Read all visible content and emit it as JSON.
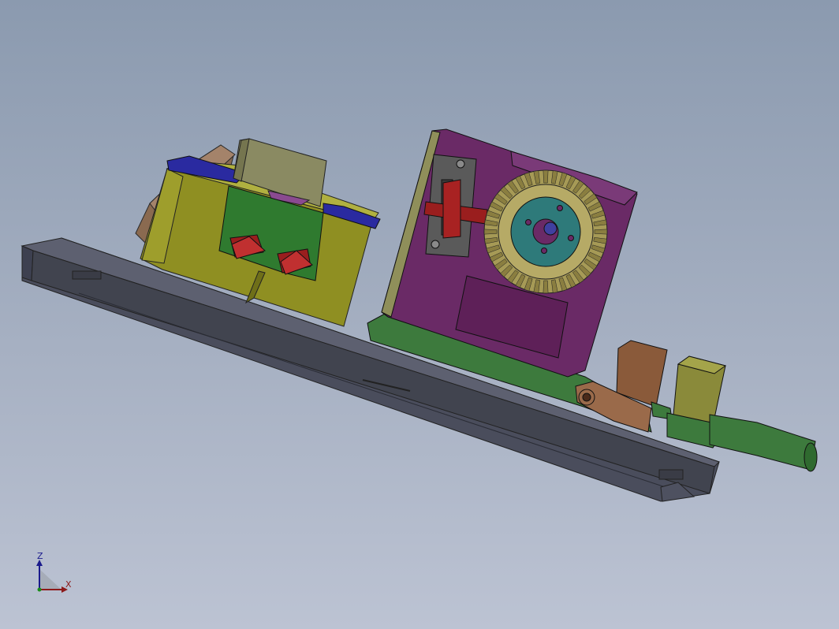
{
  "viewport": {
    "background_top": "#8b9aaf",
    "background_bottom": "#bcc3d3"
  },
  "triad": {
    "z_label": "Z",
    "x_label": "X",
    "z_color": "#1a1a8c",
    "x_color": "#8c1a1a"
  },
  "colors": {
    "base_plate": "#4a4d5c",
    "yellow_block": "#9a9a2a",
    "green_insert": "#2f7a2f",
    "blue_cap": "#2a2aa0",
    "purple_housing": "#6a2a66",
    "gear": "#a69a56",
    "gear_hub": "#2e7a7a",
    "red_parts": "#9a1e1e",
    "brown_parts": "#8a5a3a",
    "green_shaft": "#3d7a3d",
    "olive_block": "#8a8a3a"
  }
}
